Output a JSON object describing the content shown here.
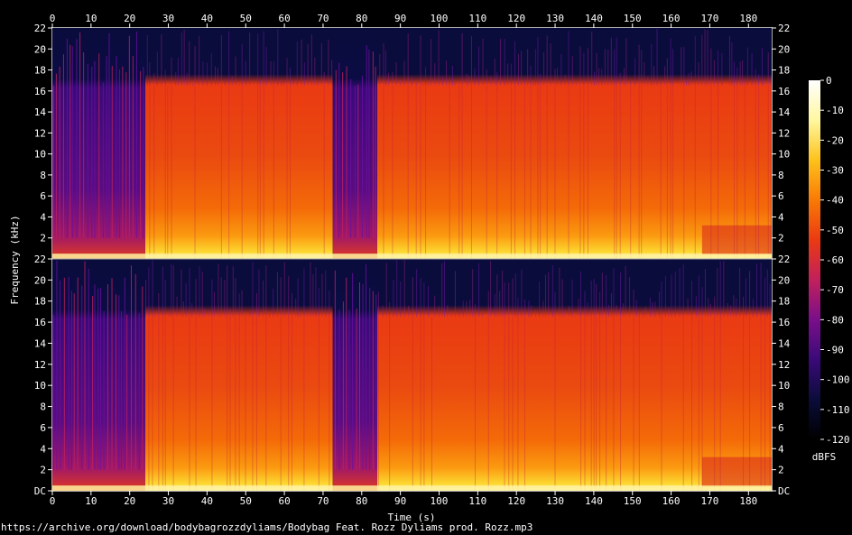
{
  "footer": {
    "source": "https://archive.org/download/bodybagrozzdyliams/Bodybag Feat. Rozz Dyliams prod. Rozz.mp3"
  },
  "chart_data": {
    "type": "heatmap",
    "title": "",
    "xlabel": "Time (s)",
    "ylabel": "Frequency (kHz)",
    "xlim": [
      0,
      186
    ],
    "x_ticks": [
      0,
      10,
      20,
      30,
      40,
      50,
      60,
      70,
      80,
      90,
      100,
      110,
      120,
      130,
      140,
      150,
      160,
      170,
      180
    ],
    "ylim": [
      0,
      22
    ],
    "y_ticks": [
      2,
      4,
      6,
      8,
      10,
      12,
      14,
      16,
      18,
      20,
      22
    ],
    "y_bottom_label": "DC",
    "channels": 2,
    "colorbar": {
      "label": "dBFS",
      "range": [
        -120,
        0
      ],
      "ticks": [
        0,
        -10,
        -20,
        -30,
        -40,
        -50,
        -60,
        -70,
        -80,
        -90,
        -100,
        -110,
        -120
      ],
      "colormap": [
        "#000000",
        "#0b0c3a",
        "#3a0a78",
        "#7a0f8a",
        "#c1205c",
        "#ea3a12",
        "#f97a06",
        "#fdc21c",
        "#fff7a0",
        "#ffffff"
      ]
    },
    "features": {
      "lowpass_cutoff_khz": 16.5,
      "quiet_sections_s": [
        [
          0,
          24
        ],
        [
          72.5,
          84
        ]
      ],
      "dense_sections_s": [
        [
          24,
          72.5
        ],
        [
          84,
          186
        ]
      ],
      "reduced_section_s": [
        168,
        186
      ]
    }
  }
}
